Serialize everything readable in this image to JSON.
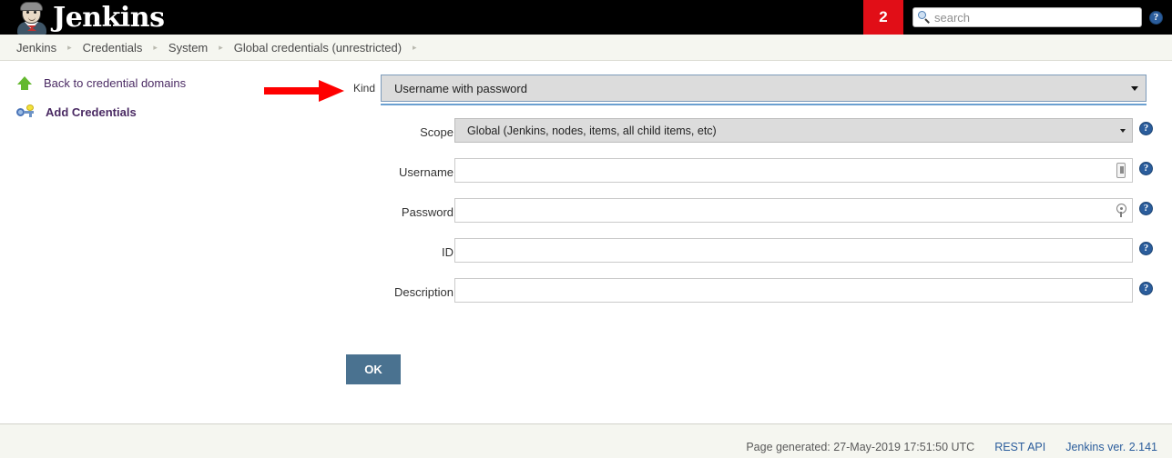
{
  "header": {
    "logo_text": "Jenkins",
    "logo_icon": "jenkins-butler-logo",
    "notification_count": "2",
    "search_placeholder": "search",
    "search_value": "",
    "search_icon": "search-icon",
    "help_icon": "help-icon"
  },
  "breadcrumbs": [
    {
      "label": "Jenkins"
    },
    {
      "label": "Credentials"
    },
    {
      "label": "System"
    },
    {
      "label": "Global credentials (unrestricted)"
    }
  ],
  "breadcrumb_separator": "▸",
  "sidebar": {
    "items": [
      {
        "label": "Back to credential domains",
        "icon": "up-arrow-icon",
        "bold": false
      },
      {
        "label": "Add Credentials",
        "icon": "key-add-icon",
        "bold": true
      }
    ]
  },
  "form": {
    "kind": {
      "label": "Kind",
      "selected": "Username with password",
      "caret_icon": "chevron-down-icon"
    },
    "fields": [
      {
        "name": "scope",
        "label": "Scope",
        "type": "select",
        "value": "Global (Jenkins, nodes, items, all child items, etc)",
        "placeholder": "",
        "help_icon": "help-icon",
        "inline_icon": ""
      },
      {
        "name": "username",
        "label": "Username",
        "type": "text",
        "value": "",
        "placeholder": "",
        "help_icon": "help-icon",
        "inline_icon": "autofill-card-icon"
      },
      {
        "name": "password",
        "label": "Password",
        "type": "password",
        "value": "",
        "placeholder": "",
        "help_icon": "help-icon",
        "inline_icon": "key-icon"
      },
      {
        "name": "id",
        "label": "ID",
        "type": "text",
        "value": "",
        "placeholder": "",
        "help_icon": "help-icon",
        "inline_icon": ""
      },
      {
        "name": "description",
        "label": "Description",
        "type": "text",
        "value": "",
        "placeholder": "",
        "help_icon": "help-icon",
        "inline_icon": ""
      }
    ],
    "submit_label": "OK"
  },
  "annotation": {
    "type": "arrow",
    "color": "#ff0000",
    "points_at": "Kind"
  },
  "footer": {
    "generated_text": "Page generated: 27-May-2019 17:51:50 UTC",
    "links": [
      {
        "label": "REST API"
      },
      {
        "label": "Jenkins ver. 2.141"
      }
    ]
  },
  "colors": {
    "header_bg": "#000000",
    "badge_red": "#e10e17",
    "bar_bg": "#f5f6f0",
    "link_purple": "#4a2a63",
    "link_blue": "#2b5d9c",
    "button_blue": "#4a7290",
    "select_gray": "#dcdcdc",
    "kind_border_blue": "#6a9fd0",
    "annotation_red": "#ff0000"
  }
}
